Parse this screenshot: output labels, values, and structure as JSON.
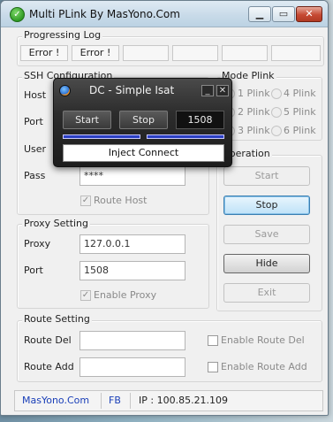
{
  "window": {
    "title": "Multi PLink By MasYono.Com",
    "minimize_glyph": "▁",
    "maximize_glyph": "▭",
    "close_glyph": "✕"
  },
  "progress_log": {
    "label": "Progressing Log",
    "cells": [
      "Error !",
      "Error !",
      "",
      "",
      "",
      ""
    ]
  },
  "ssh": {
    "label": "SSH Configuration",
    "host_label": "Host",
    "port_label": "Port",
    "user_label": "User",
    "pass_label": "Pass",
    "pass_value": "****",
    "route_host_label": "Route Host"
  },
  "mode_plink": {
    "label": "Mode Plink",
    "options": [
      "1 Plink",
      "2 Plink",
      "3 Plink",
      "4 Plink",
      "5 Plink",
      "6 Plink"
    ]
  },
  "operation": {
    "label": "Operation",
    "start": "Start",
    "stop": "Stop",
    "save": "Save",
    "hide": "Hide",
    "exit": "Exit"
  },
  "proxy": {
    "label": "Proxy Setting",
    "proxy_label": "Proxy",
    "proxy_value": "127.0.0.1",
    "port_label": "Port",
    "port_value": "1508",
    "enable_label": "Enable Proxy"
  },
  "route": {
    "label": "Route Setting",
    "del_label": "Route Del",
    "add_label": "Route Add",
    "enable_del_label": "Enable Route Del",
    "enable_add_label": "Enable Route Add"
  },
  "statusbar": {
    "site": "MasYono.Com",
    "fb": "FB",
    "ip": "IP : 100.85.21.109"
  },
  "dialog": {
    "title": "DC - Simple Isat",
    "min_glyph": "_",
    "close_glyph": "✕",
    "start": "Start",
    "stop": "Stop",
    "port": "1508",
    "inject": "Inject Connect"
  },
  "colors": {
    "link_blue": "#1a3fb8",
    "accent_bar": "#2b3fc4",
    "close_red": "#c64a33"
  }
}
